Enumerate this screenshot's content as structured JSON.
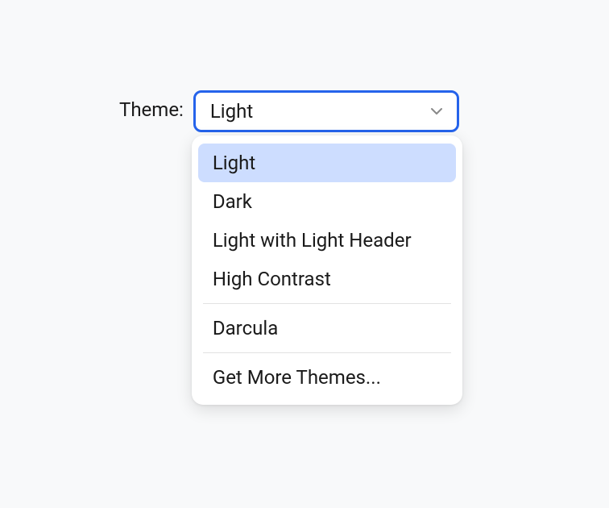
{
  "label": "Theme:",
  "selected": "Light",
  "groups": [
    {
      "items": [
        {
          "label": "Light",
          "selected": true
        },
        {
          "label": "Dark",
          "selected": false
        },
        {
          "label": "Light with Light Header",
          "selected": false
        },
        {
          "label": "High Contrast",
          "selected": false
        }
      ]
    },
    {
      "items": [
        {
          "label": "Darcula",
          "selected": false
        }
      ]
    },
    {
      "items": [
        {
          "label": "Get More Themes...",
          "selected": false
        }
      ]
    }
  ]
}
